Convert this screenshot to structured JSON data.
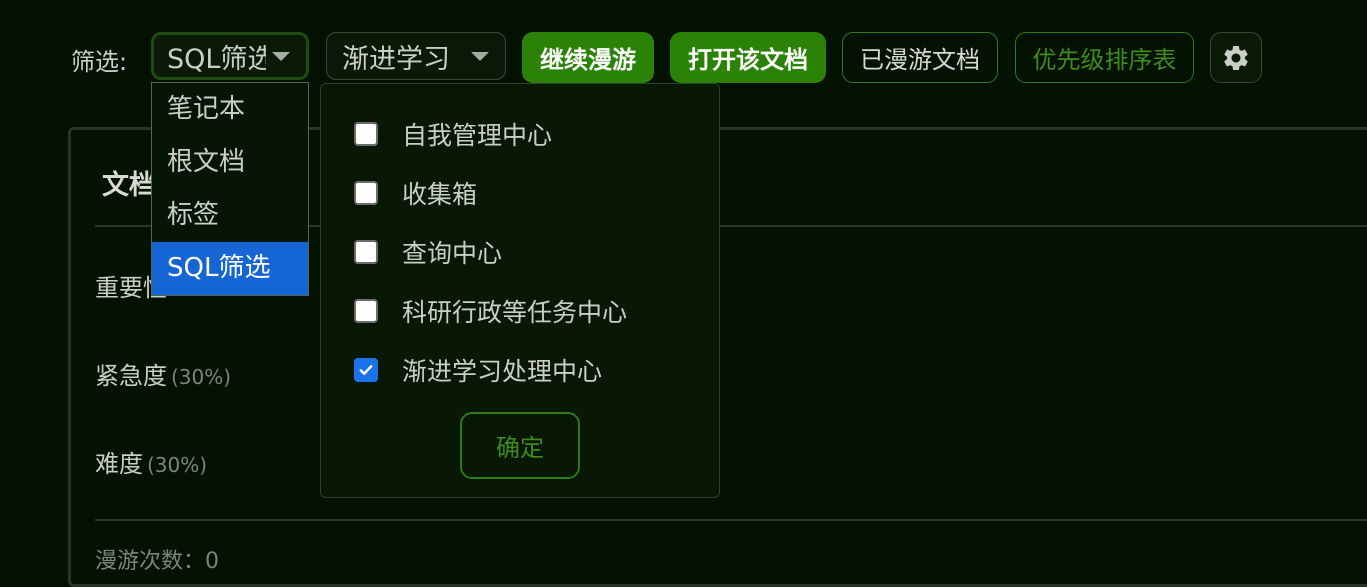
{
  "toolbar": {
    "filter_label": "筛选:",
    "mode_select": "SQL筛选",
    "notebook_select": "渐进学习",
    "continue_label": "继续漫游",
    "open_label": "打开该文档",
    "roamed_label": "已漫游文档",
    "priority_label": "优先级排序表",
    "settings_icon": "gear-icon"
  },
  "mode_options": [
    "笔记本",
    "根文档",
    "标签",
    "SQL筛选"
  ],
  "mode_selected": "SQL筛选",
  "notebooks": [
    {
      "label": "自我管理中心",
      "checked": false
    },
    {
      "label": "收集箱",
      "checked": false
    },
    {
      "label": "查询中心",
      "checked": false
    },
    {
      "label": "科研行政等任务中心",
      "checked": false
    },
    {
      "label": "渐进学习处理中心",
      "checked": true
    }
  ],
  "confirm_label": "确定",
  "panel": {
    "title": "文档",
    "metrics": [
      {
        "label": "重要性",
        "pct": ""
      },
      {
        "label": "紧急度",
        "pct": "(30%)"
      },
      {
        "label": "难度",
        "pct": "(30%)"
      }
    ],
    "roam_count": "漫游次数：0"
  },
  "colors": {
    "background": "#041202",
    "accent_green": "#2a8306",
    "selected_blue": "#1565d4",
    "checkbox_blue": "#1a73e8"
  }
}
